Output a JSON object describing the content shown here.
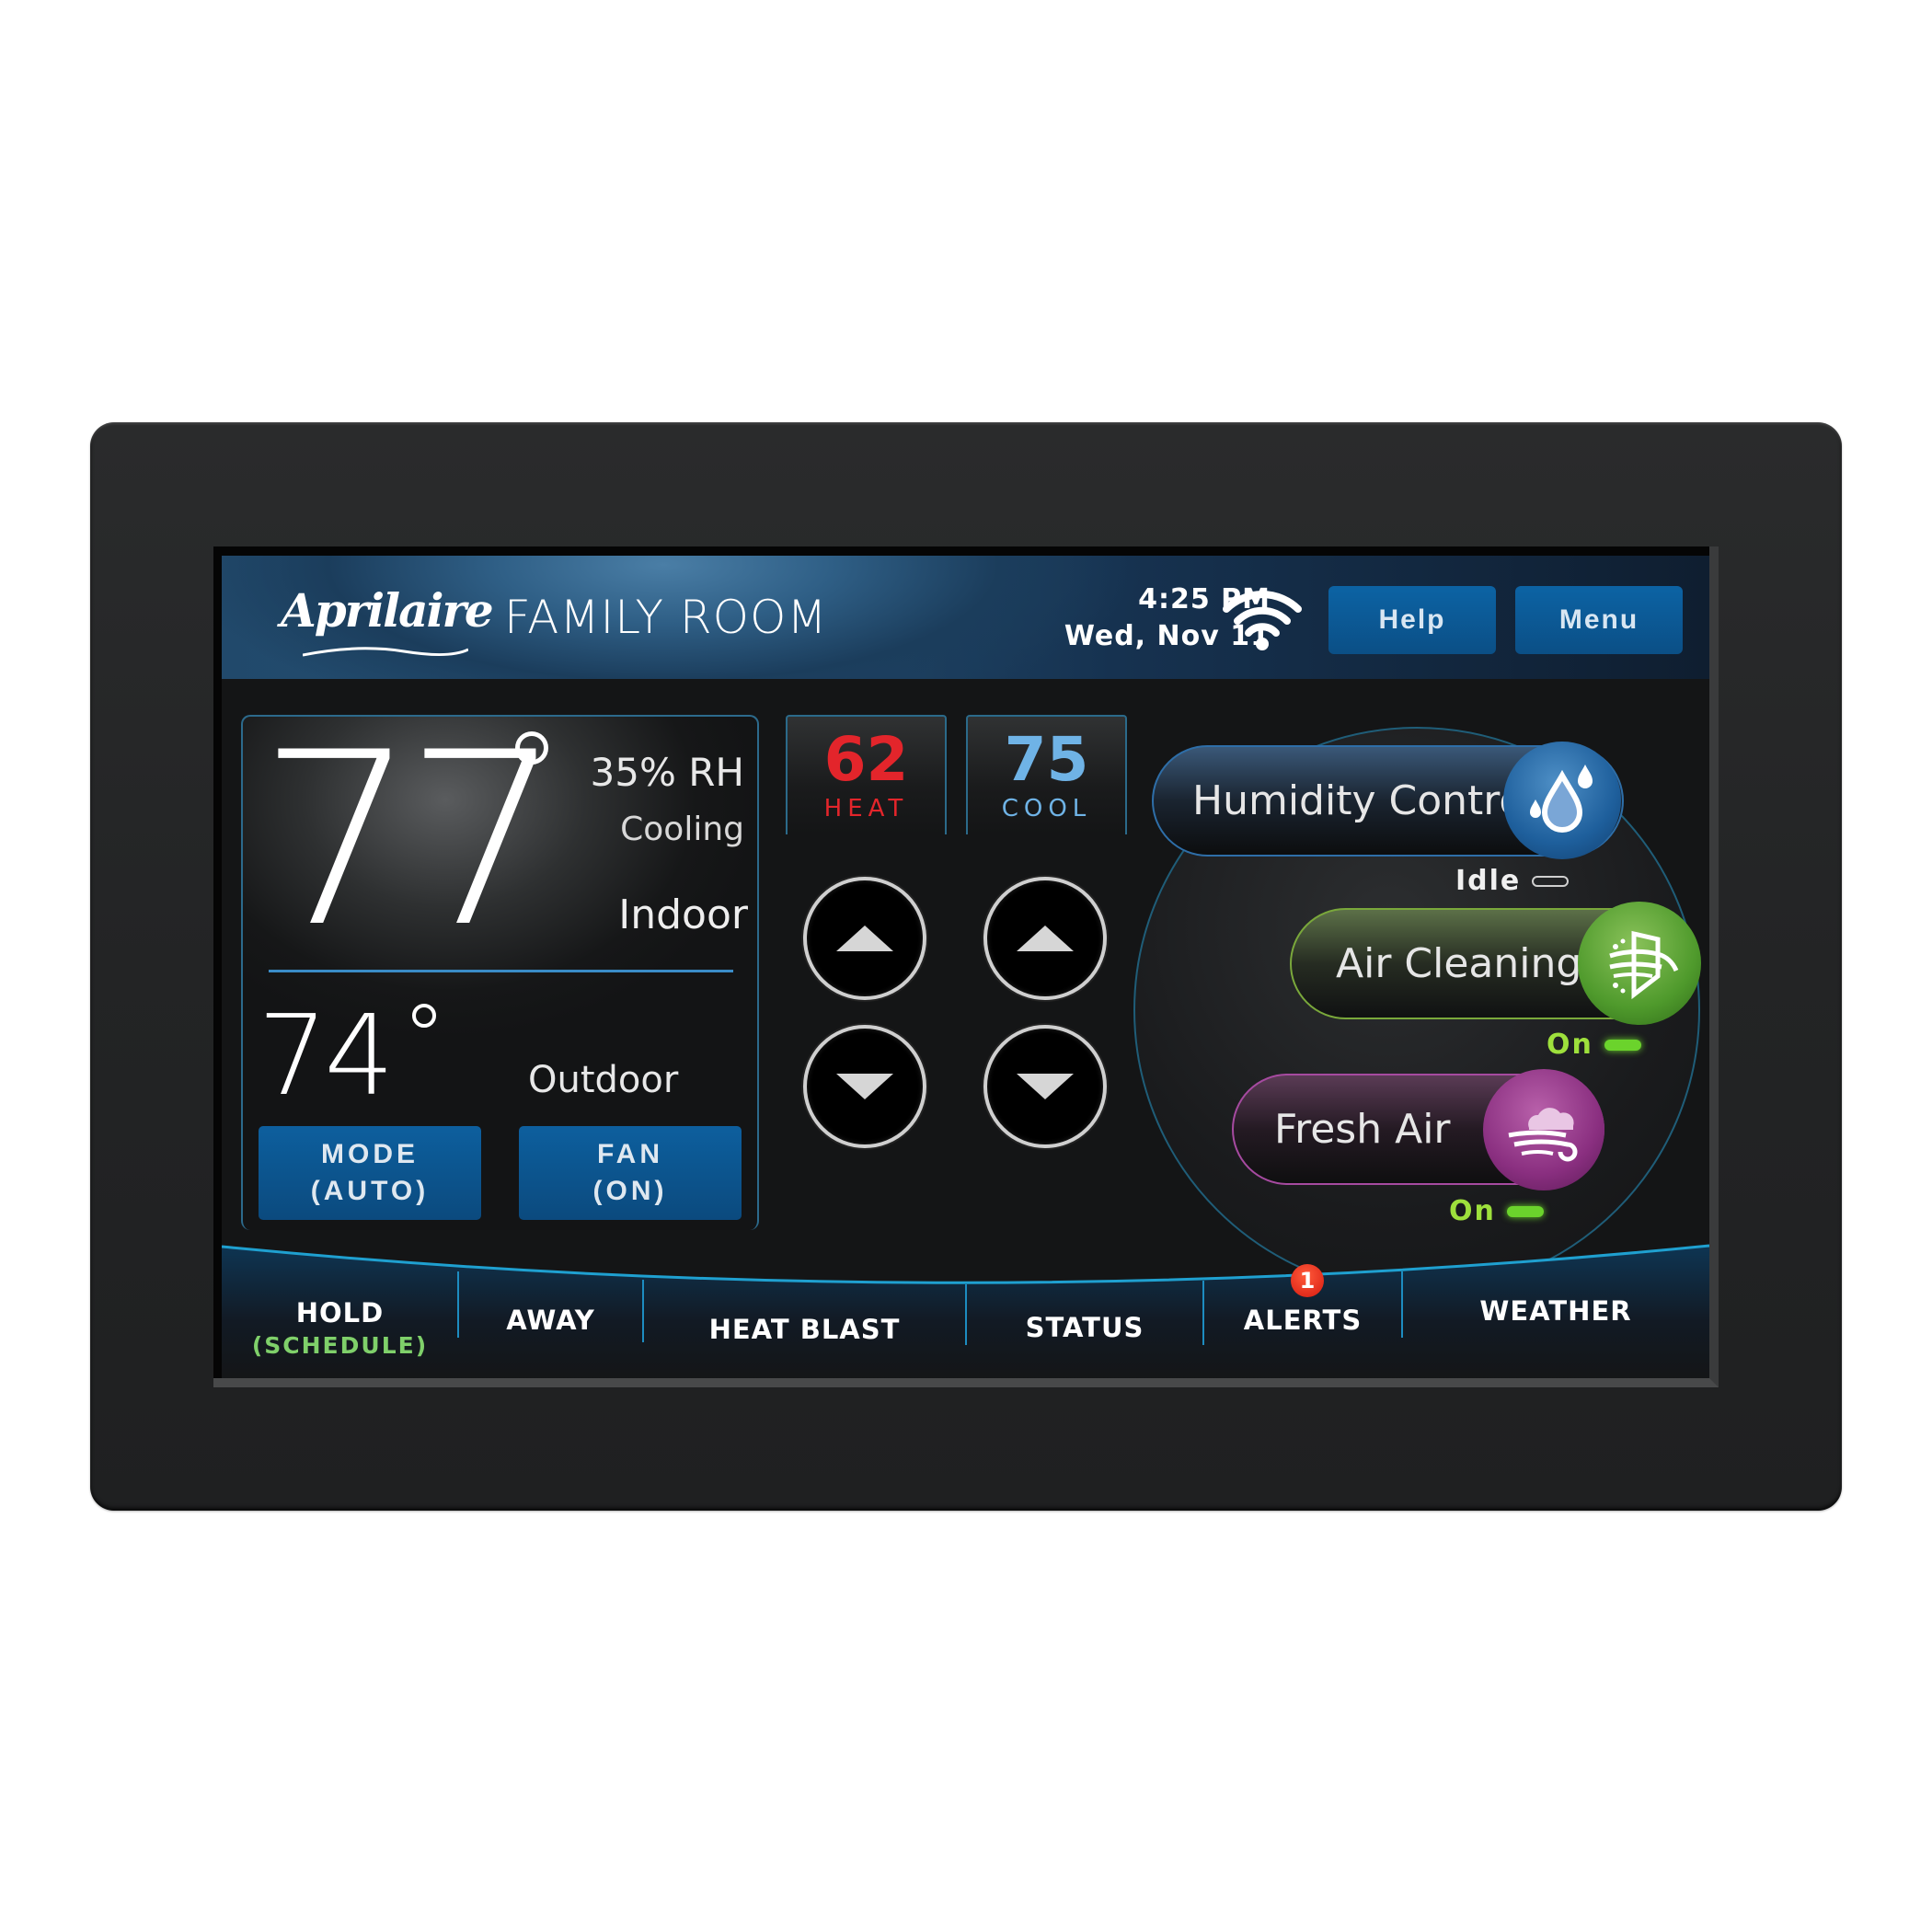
{
  "header": {
    "brand": "Aprilaire",
    "room": "FAMILY ROOM",
    "time": "4:25 PM",
    "date": "Wed, Nov 11",
    "wifi_icon": "wifi-icon",
    "help_label": "Help",
    "menu_label": "Menu"
  },
  "indoor": {
    "temperature": "77",
    "humidity": "35% RH",
    "system_state": "Cooling",
    "label": "Indoor"
  },
  "outdoor": {
    "temperature": "74",
    "label": "Outdoor"
  },
  "mode_button": {
    "label": "MODE",
    "value": "(AUTO)"
  },
  "fan_button": {
    "label": "FAN",
    "value": "(ON)"
  },
  "setpoints": {
    "heat": {
      "value": "62",
      "label": "HEAT",
      "color": "#e3252b"
    },
    "cool": {
      "value": "75",
      "label": "COOL",
      "color": "#6fb3e6"
    }
  },
  "accessories": [
    {
      "label": "Humidity Control",
      "status": "Idle",
      "icon": "water-drops-icon",
      "color": "#1e5f9c"
    },
    {
      "label": "Air Cleaning",
      "status": "On",
      "icon": "air-filter-icon",
      "color": "#4f9a2c"
    },
    {
      "label": "Fresh Air",
      "status": "On",
      "icon": "cloud-wind-icon",
      "color": "#8a2f80"
    }
  ],
  "nav": {
    "hold": "HOLD",
    "hold_sub": "(SCHEDULE)",
    "away": "AWAY",
    "heat_blast": "HEAT BLAST",
    "status": "STATUS",
    "alerts": "ALERTS",
    "alerts_count": "1",
    "weather": "WEATHER"
  }
}
